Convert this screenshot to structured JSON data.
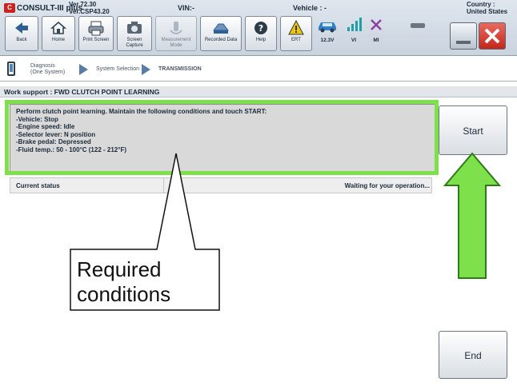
{
  "header": {
    "logo_text": "C",
    "app_name": "CONSULT-III plus",
    "version_1": "Ver.72.30",
    "version_2": "Ver.CSP43.20",
    "vin_label": "VIN:-",
    "vehicle_label": "Vehicle : -",
    "country_label": "Country : United States"
  },
  "toolbar": {
    "back": "Back",
    "home": "Home",
    "print_screen": "Print Screen",
    "screen_capture": "Screen Capture",
    "measurement_mode": "Measurement Mode",
    "recorded_data": "Recorded Data",
    "help": "Help",
    "ert": "ERT",
    "voltage": "12.3V",
    "vi": "VI",
    "mi": "MI"
  },
  "breadcrumb": {
    "item1": "Diagnosis (One System)",
    "item2": "System Selection",
    "item3": "TRANSMISSION"
  },
  "work_support": {
    "title": "Work support : FWD CLUTCH POINT LEARNING",
    "conditions": [
      "Perform clutch point learning. Maintain the following conditions and touch START:",
      "-Vehicle: Stop",
      "-Engine speed: Idle",
      "-Selector lever: N position",
      "-Brake pedal: Depressed",
      "-Fluid temp.: 50 - 100°C (122 - 212°F)"
    ],
    "status_label": "Current status",
    "status_value": "Waiting for your operation..."
  },
  "buttons": {
    "start": "Start",
    "end": "End"
  },
  "callout": {
    "line1": "Required",
    "line2": "conditions"
  },
  "colors": {
    "highlight": "#7ee04b",
    "close_button": "#d0372c"
  }
}
